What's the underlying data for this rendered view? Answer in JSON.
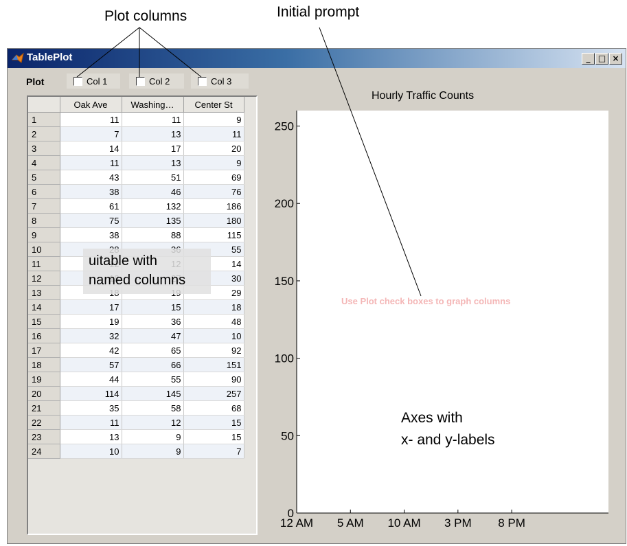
{
  "callouts": {
    "plot_columns": "Plot columns",
    "initial_prompt": "Initial prompt",
    "uitable_line1": "uitable with",
    "uitable_line2": "named columns",
    "axes_line1": "Axes with",
    "axes_line2": "x- and y-labels"
  },
  "window": {
    "title": "TablePlot",
    "icon": "matlab-membrane-icon",
    "buttons": {
      "minimize": "_",
      "maximize": "□",
      "close": "×"
    }
  },
  "plot_controls": {
    "label": "Plot",
    "checkboxes": [
      {
        "label": "Col 1",
        "checked": false
      },
      {
        "label": "Col 2",
        "checked": false
      },
      {
        "label": "Col 3",
        "checked": false
      }
    ]
  },
  "table": {
    "columns": [
      "Oak Ave",
      "Washing…",
      "Center St"
    ],
    "rows": [
      [
        "1",
        "11",
        "11",
        "9"
      ],
      [
        "2",
        "7",
        "13",
        "11"
      ],
      [
        "3",
        "14",
        "17",
        "20"
      ],
      [
        "4",
        "11",
        "13",
        "9"
      ],
      [
        "5",
        "43",
        "51",
        "69"
      ],
      [
        "6",
        "38",
        "46",
        "76"
      ],
      [
        "7",
        "61",
        "132",
        "186"
      ],
      [
        "8",
        "75",
        "135",
        "180"
      ],
      [
        "9",
        "38",
        "88",
        "115"
      ],
      [
        "10",
        "28",
        "36",
        "55"
      ],
      [
        "11",
        "12",
        "12",
        "14"
      ],
      [
        "12",
        "18",
        "27",
        "30"
      ],
      [
        "13",
        "18",
        "19",
        "29"
      ],
      [
        "14",
        "17",
        "15",
        "18"
      ],
      [
        "15",
        "19",
        "36",
        "48"
      ],
      [
        "16",
        "32",
        "47",
        "10"
      ],
      [
        "17",
        "42",
        "65",
        "92"
      ],
      [
        "18",
        "57",
        "66",
        "151"
      ],
      [
        "19",
        "44",
        "55",
        "90"
      ],
      [
        "20",
        "114",
        "145",
        "257"
      ],
      [
        "21",
        "35",
        "58",
        "68"
      ],
      [
        "22",
        "11",
        "12",
        "15"
      ],
      [
        "23",
        "13",
        "9",
        "15"
      ],
      [
        "24",
        "10",
        "9",
        "7"
      ]
    ]
  },
  "chart": {
    "empty_prompt": "Use Plot check boxes to graph columns"
  },
  "chart_data": {
    "type": "line",
    "title": "Hourly Traffic Counts",
    "xlabel": "",
    "ylabel": "",
    "xticks": [
      "12 AM",
      "5 AM",
      "10 AM",
      "3 PM",
      "8 PM"
    ],
    "yticks": [
      "0",
      "50",
      "100",
      "150",
      "200",
      "250"
    ],
    "xlim": [
      0,
      24
    ],
    "ylim": [
      0,
      260
    ],
    "series": [],
    "grid": false,
    "legend": "none",
    "background": "#ffffff"
  }
}
